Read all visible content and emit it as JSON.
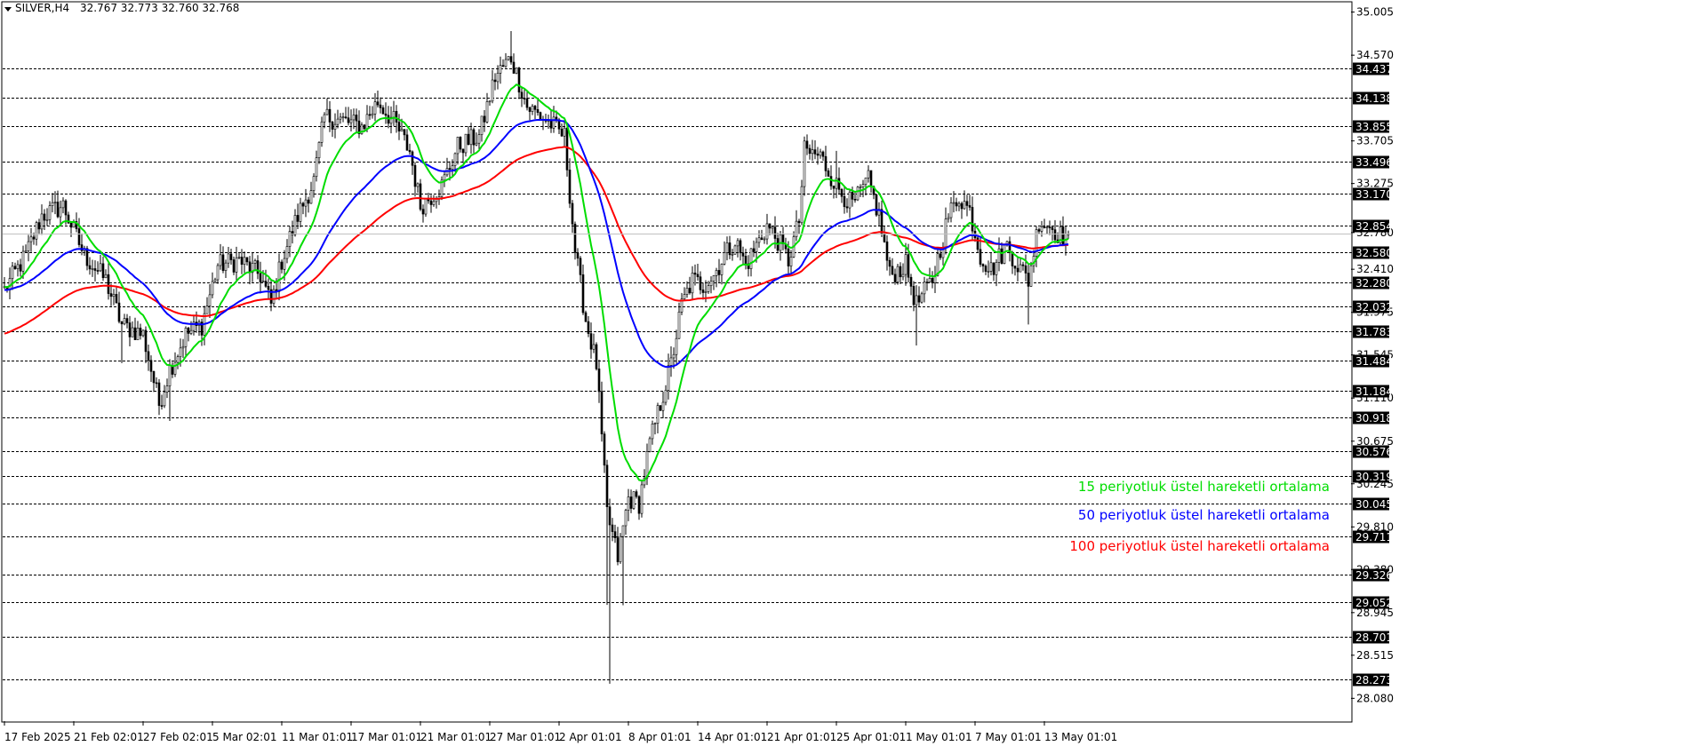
{
  "header": {
    "symbol": "SILVER,H4",
    "ohlc": "32.767 32.773 32.760 32.768"
  },
  "colors": {
    "ema15": "#00dd00",
    "ema50": "#0000ff",
    "ema100": "#ff0000",
    "candles": "#000000",
    "level_label_bg": "#000000",
    "grid": "#000000"
  },
  "legend": {
    "ema15": "15 periyotluk üstel hareketli ortalama",
    "ema50": "50 periyotluk üstel hareketli ortalama",
    "ema100": "100 periyotluk üstel hareketli ortalama"
  },
  "chart_data": {
    "type": "line",
    "ylim": [
      27.85,
      35.1
    ],
    "y_ticks": [
      "35.005",
      "34.570",
      "33.705",
      "33.275",
      "32.780",
      "32.410",
      "31.975",
      "31.545",
      "31.110",
      "30.675",
      "30.245",
      "29.810",
      "29.380",
      "28.945",
      "28.515",
      "28.080"
    ],
    "y_tick_values": [
      35.005,
      34.57,
      33.705,
      33.275,
      32.78,
      32.41,
      31.975,
      31.545,
      31.11,
      30.675,
      30.245,
      29.81,
      29.38,
      28.945,
      28.515,
      28.08
    ],
    "levels": [
      "34.437",
      "34.138",
      "33.855",
      "33.496",
      "33.170",
      "32.854",
      "32.580",
      "32.280",
      "32.032",
      "31.783",
      "31.484",
      "31.184",
      "30.918",
      "30.576",
      "30.319",
      "30.045",
      "29.711",
      "29.326",
      "29.052",
      "28.701",
      "28.273"
    ],
    "level_values": [
      34.437,
      34.138,
      33.855,
      33.496,
      33.17,
      32.854,
      32.58,
      32.28,
      32.032,
      31.783,
      31.484,
      31.184,
      30.918,
      30.576,
      30.319,
      30.045,
      29.711,
      29.326,
      29.052,
      28.701,
      28.273
    ],
    "current_price": 32.768,
    "x_labels": [
      "17 Feb 2025",
      "21 Feb 02:01",
      "27 Feb 02:01",
      "5 Mar 02:01",
      "11 Mar 01:01",
      "17 Mar 01:01",
      "21 Mar 01:01",
      "27 Mar 01:01",
      "2 Apr 01:01",
      "8 Apr 01:01",
      "14 Apr 01:01",
      "21 Apr 01:01",
      "25 Apr 01:01",
      "1 May 01:01",
      "7 May 01:01",
      "13 May 01:01"
    ],
    "x_label_bars": [
      0,
      26,
      52,
      78,
      104,
      130,
      156,
      182,
      208,
      234,
      260,
      286,
      312,
      338,
      364,
      390
    ],
    "bar_count": 400,
    "price_path": [
      [
        0,
        32.2
      ],
      [
        8,
        32.55
      ],
      [
        14,
        32.95
      ],
      [
        22,
        33.05
      ],
      [
        30,
        32.55
      ],
      [
        38,
        32.3
      ],
      [
        44,
        31.85
      ],
      [
        52,
        31.75
      ],
      [
        58,
        31.05
      ],
      [
        62,
        31.4
      ],
      [
        68,
        31.75
      ],
      [
        74,
        31.85
      ],
      [
        80,
        32.45
      ],
      [
        88,
        32.5
      ],
      [
        96,
        32.35
      ],
      [
        100,
        32.05
      ],
      [
        104,
        32.5
      ],
      [
        110,
        32.95
      ],
      [
        116,
        33.3
      ],
      [
        120,
        33.95
      ],
      [
        128,
        33.9
      ],
      [
        134,
        33.85
      ],
      [
        140,
        34.1
      ],
      [
        146,
        33.9
      ],
      [
        152,
        33.6
      ],
      [
        156,
        33.05
      ],
      [
        164,
        33.25
      ],
      [
        170,
        33.65
      ],
      [
        178,
        33.75
      ],
      [
        184,
        34.35
      ],
      [
        190,
        34.55
      ],
      [
        196,
        34.05
      ],
      [
        204,
        33.9
      ],
      [
        210,
        33.75
      ],
      [
        214,
        32.6
      ],
      [
        218,
        31.9
      ],
      [
        222,
        31.45
      ],
      [
        226,
        29.95
      ],
      [
        230,
        29.5
      ],
      [
        234,
        30.1
      ],
      [
        238,
        30.05
      ],
      [
        242,
        30.65
      ],
      [
        246,
        31.05
      ],
      [
        250,
        31.45
      ],
      [
        254,
        32.05
      ],
      [
        258,
        32.3
      ],
      [
        262,
        32.25
      ],
      [
        266,
        32.35
      ],
      [
        270,
        32.55
      ],
      [
        274,
        32.7
      ],
      [
        278,
        32.45
      ],
      [
        282,
        32.65
      ],
      [
        286,
        32.85
      ],
      [
        290,
        32.7
      ],
      [
        294,
        32.5
      ],
      [
        298,
        32.9
      ],
      [
        300,
        33.6
      ],
      [
        306,
        33.55
      ],
      [
        312,
        33.25
      ],
      [
        318,
        33.05
      ],
      [
        324,
        33.3
      ],
      [
        328,
        32.95
      ],
      [
        332,
        32.35
      ],
      [
        338,
        32.45
      ],
      [
        342,
        32.05
      ],
      [
        348,
        32.3
      ],
      [
        354,
        32.95
      ],
      [
        358,
        33.15
      ],
      [
        362,
        33.0
      ],
      [
        366,
        32.55
      ],
      [
        370,
        32.4
      ],
      [
        376,
        32.65
      ],
      [
        380,
        32.45
      ],
      [
        384,
        32.3
      ],
      [
        388,
        32.9
      ],
      [
        392,
        32.85
      ],
      [
        396,
        32.75
      ],
      [
        399,
        32.768
      ]
    ]
  }
}
